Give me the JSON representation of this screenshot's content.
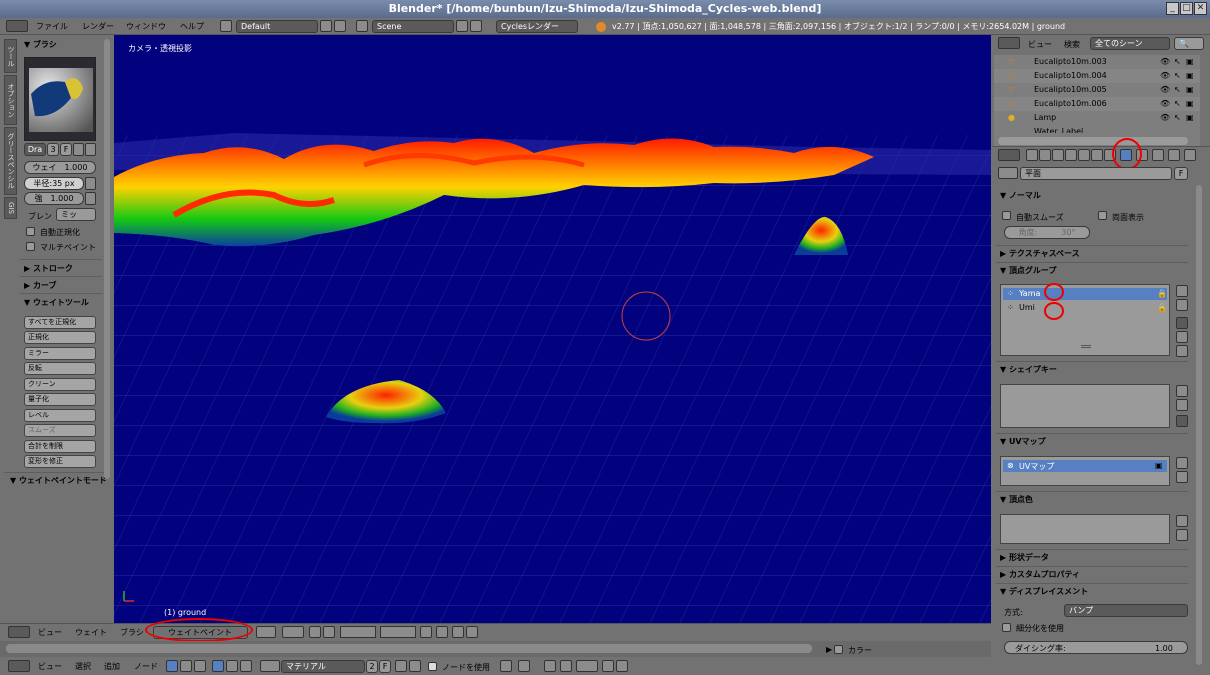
{
  "window": {
    "title": "Blender* [/home/bunbun/Izu-Shimoda/Izu-Shimoda_Cycles-web.blend]",
    "min": "_",
    "max": "□",
    "close": "✕"
  },
  "topbar": {
    "menus": [
      "ファイル",
      "レンダー",
      "ウィンドウ",
      "ヘルプ"
    ],
    "layout": "Default",
    "scene": "Scene",
    "engine": "Cyclesレンダー",
    "info": "v2.77 | 頂点:1,050,627 | 面:1,048,578 | 三角面:2,097,156 | オブジェクト:1/2 | ランプ:0/0 | メモリ:2654.02M | ground"
  },
  "left": {
    "tabs": [
      "ツール",
      "オプション",
      "グリースペンシル",
      "GIS"
    ],
    "brush_header": "▼ ブラシ",
    "brush_name": "Dra",
    "brush_users": "3",
    "brush_fake": "F",
    "weight": "ウェイ　1.000",
    "radius": "半径:35 px",
    "strength": "強　1.000",
    "blend_label": "ブレン",
    "blend_value": "ミッ",
    "auto_normalize": "自動正規化",
    "multi_paint": "マルチペイント",
    "stroke": "▶ ストローク",
    "curve": "▶ カーブ",
    "weight_tools": "▼ ウェイトツール",
    "tools": [
      "すべてを正規化",
      "正規化",
      "ミラー",
      "反転",
      "クリーン",
      "量子化",
      "レベル",
      "スムーズ",
      "合計を制限",
      "変形を修正"
    ],
    "weight_paint_mode": "▼ ウェイトペイントモード"
  },
  "viewport": {
    "label": "カメラ・透視投影",
    "object_label": "(1) ground"
  },
  "header3d": {
    "view": "ビュー",
    "weights": "ウェイト",
    "brush": "ブラシ",
    "mode": "ウェイトペイント"
  },
  "timeline": {
    "colors": "カラー"
  },
  "nodebar": {
    "view": "ビュー",
    "select": "選択",
    "add": "追加",
    "node": "ノード",
    "material": "マテリアル",
    "users": "2",
    "fake": "F",
    "use_nodes": "ノードを使用"
  },
  "outliner": {
    "view": "ビュー",
    "search": "検索",
    "filter": "全てのシーン",
    "rows": [
      "Eucalipto10m.003",
      "Eucalipto10m.004",
      "Eucalipto10m.005",
      "Eucalipto10m.006",
      "Lamp",
      "Water_Label"
    ]
  },
  "props": {
    "object_name": "平面",
    "fake": "F",
    "normals": "▼ ノーマル",
    "auto_smooth": "自動スムーズ",
    "double_sided": "両面表示",
    "angle": "角度:　　　30°",
    "texture_space": "▶ テクスチャスペース",
    "vertex_groups": "▼ 頂点グループ",
    "vg": [
      "Yama",
      "Umi"
    ],
    "shape_keys": "▼ シェイプキー",
    "uv_maps": "▼ UVマップ",
    "uv": "UVマップ",
    "vertex_colors": "▼ 頂点色",
    "geometry_data": "▶ 形状データ",
    "custom_props": "▶ カスタムプロパティ",
    "displacement": "▼ ディスプレイスメント",
    "method_label": "方式:",
    "method_value": "バンプ",
    "subdivision": "細分化を使用",
    "dicing_label": "ダイシング率:",
    "dicing_value": "1.00"
  },
  "colors": {
    "viewport": "#02027e",
    "selected": "#5680c2",
    "annotation": "#e00000"
  }
}
